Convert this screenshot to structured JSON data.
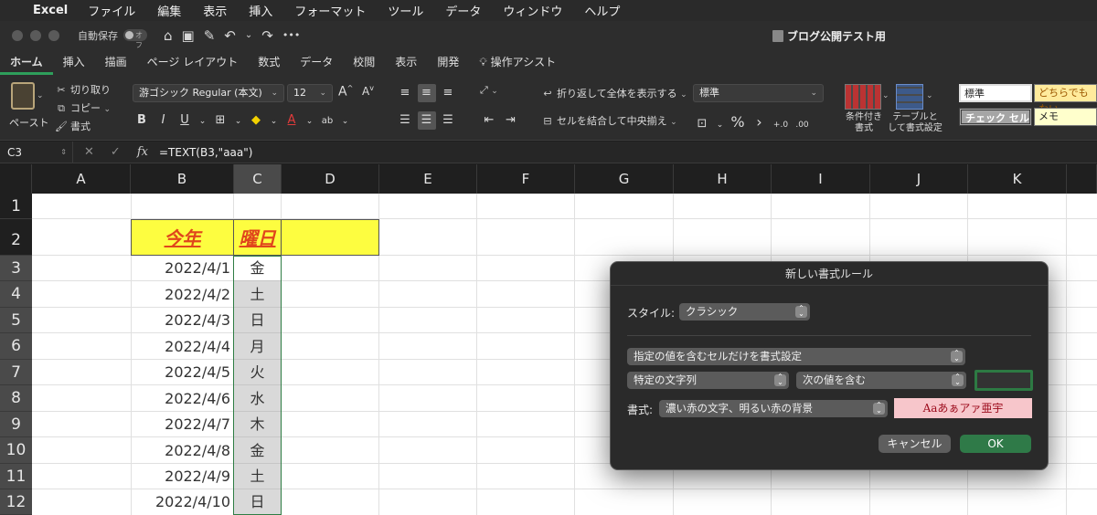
{
  "menubar": {
    "app_name": "Excel",
    "items": [
      "ファイル",
      "編集",
      "表示",
      "挿入",
      "フォーマット",
      "ツール",
      "データ",
      "ウィンドウ",
      "ヘルプ"
    ]
  },
  "titlebar": {
    "autosave_label": "自動保存",
    "autosave_state": "オフ",
    "document_title": "ブログ公開テスト用"
  },
  "ribbon_tabs": [
    "ホーム",
    "挿入",
    "描画",
    "ページ レイアウト",
    "数式",
    "データ",
    "校閲",
    "表示",
    "開発",
    "操作アシスト"
  ],
  "ribbon": {
    "paste": "ペースト",
    "cut": "切り取り",
    "copy": "コピー",
    "format_painter": "書式",
    "font_name": "游ゴシック Regular (本文)",
    "font_size": "12",
    "wrap_text": "折り返して全体を表示する",
    "merge_center": "セルを結合して中央揃え",
    "number_format": "標準",
    "conditional_format": [
      "条件付き",
      "書式"
    ],
    "format_as_table": [
      "テーブルと",
      "して書式設定"
    ],
    "styles": {
      "normal": "標準",
      "neutral": "どちらでもない",
      "check_cell": "チェック セル",
      "memo": "メモ"
    }
  },
  "formula_bar": {
    "name_box": "C3",
    "fx": "fx",
    "formula": "=TEXT(B3,\"aaa\")"
  },
  "sheet": {
    "columns": [
      "A",
      "B",
      "C",
      "D",
      "E",
      "F",
      "G",
      "H",
      "I",
      "J",
      "K"
    ],
    "rows": [
      "1",
      "2",
      "3",
      "4",
      "5",
      "6",
      "7",
      "8",
      "9",
      "10",
      "11",
      "12"
    ],
    "header_year": "今年",
    "header_day": "曜日",
    "dates": [
      "2022/4/1",
      "2022/4/2",
      "2022/4/3",
      "2022/4/4",
      "2022/4/5",
      "2022/4/6",
      "2022/4/7",
      "2022/4/8",
      "2022/4/9",
      "2022/4/10"
    ],
    "days": [
      "金",
      "土",
      "日",
      "月",
      "火",
      "水",
      "木",
      "金",
      "土",
      "日"
    ]
  },
  "dialog": {
    "title": "新しい書式ルール",
    "style_label": "スタイル:",
    "style_value": "クラシック",
    "rule_type": "指定の値を含むセルだけを書式設定",
    "condition_type": "特定の文字列",
    "condition_op": "次の値を含む",
    "condition_value": "",
    "format_label": "書式:",
    "format_value": "濃い赤の文字、明るい赤の背景",
    "preview_text": "Aaあぁアァ亜宇",
    "cancel": "キャンセル",
    "ok": "OK"
  },
  "colors": {
    "accent_green": "#2e9e5b",
    "header_fill": "#fdfd40",
    "header_text": "#e0451c",
    "preview_fill": "#f7c6cb",
    "preview_text": "#9c0b1c"
  }
}
